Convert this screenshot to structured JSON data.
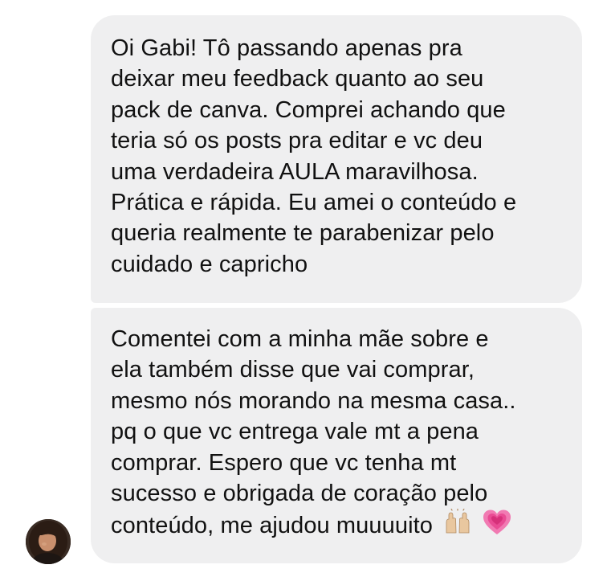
{
  "conversation": {
    "messages": [
      {
        "lines": [
          "Oi Gabi! Tô passando apenas pra",
          "deixar meu feedback quanto ao seu",
          "pack de canva. Comprei achando que",
          "teria só os posts pra editar e vc deu",
          "uma verdadeira AULA maravilhosa.",
          "Prática e rápida. Eu amei o conteúdo e",
          "queria realmente te parabenizar pelo",
          "cuidado e capricho"
        ]
      },
      {
        "lines": [
          "Comentei com a minha mãe sobre e",
          "ela também disse que vai comprar,",
          "mesmo nós morando na mesma casa..",
          "pq o que vc entrega vale mt a pena",
          "comprar. Espero que vc tenha mt",
          "sucesso e obrigada de coração pelo",
          "conteúdo, me ajudou muuuuito"
        ],
        "emojis": [
          "raising-hands-emoji",
          "growing-heart-emoji"
        ]
      }
    ],
    "colors": {
      "bubble_background": "#efeff0",
      "text": "#111111",
      "page_background": "#ffffff"
    }
  }
}
